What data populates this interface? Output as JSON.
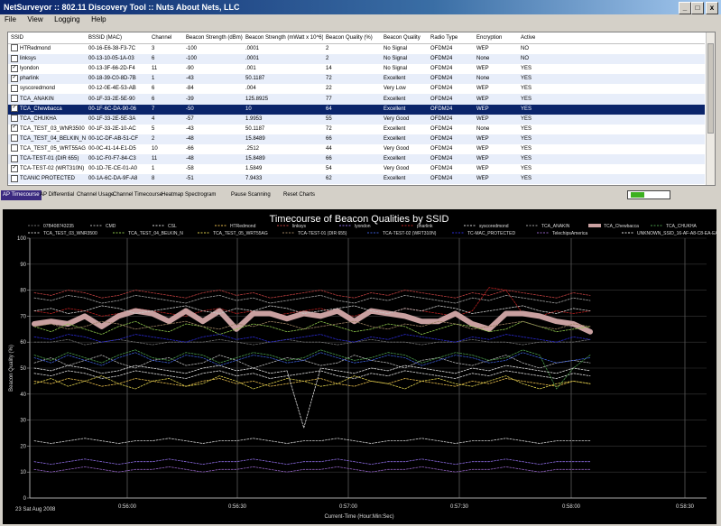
{
  "window": {
    "title": "NetSurveyor :: 802.11 Discovery Tool :: Nuts About Nets, LLC",
    "buttons": [
      "_",
      "□",
      "x"
    ]
  },
  "menu": [
    "File",
    "View",
    "Logging",
    "Help"
  ],
  "table": {
    "columns": [
      "SSID",
      "BSSID (MAC)",
      "Channel",
      "Beacon Strength (dBm)",
      "Beacon Strength (mWatt x 10^6)",
      "Beacon Quality (%)",
      "Beacon Quality",
      "Radio Type",
      "Encryption",
      "Active"
    ],
    "rows": [
      {
        "checked": false,
        "ssid": "HTRedmond",
        "bssid": "00-16-E6-38-F3-7C",
        "channel": "3",
        "dbm": "-100",
        "mw": ".0001",
        "pct": "2",
        "quality": "No Signal",
        "radio": "OFDM24",
        "enc": "WEP",
        "active": "NO"
      },
      {
        "checked": false,
        "ssid": "linksys",
        "bssid": "00-13-10-05-1A-03",
        "channel": "6",
        "dbm": "-100",
        "mw": ".0001",
        "pct": "2",
        "quality": "No Signal",
        "radio": "OFDM24",
        "enc": "None",
        "active": "NO"
      },
      {
        "checked": true,
        "ssid": "lyondon",
        "bssid": "00-13-3F-66-2D-F4",
        "channel": "11",
        "dbm": "-90",
        "mw": ".001",
        "pct": "14",
        "quality": "No Signal",
        "radio": "OFDM24",
        "enc": "WEP",
        "active": "YES"
      },
      {
        "checked": true,
        "ssid": "pharlink",
        "bssid": "00-18-39-C0-8D-7B",
        "channel": "1",
        "dbm": "-43",
        "mw": "50.1187",
        "pct": "72",
        "quality": "Excellent",
        "radio": "OFDM24",
        "enc": "None",
        "active": "YES"
      },
      {
        "checked": false,
        "ssid": "syscoredmond",
        "bssid": "00-12-0E-4E-53-AB",
        "channel": "6",
        "dbm": "-84",
        "mw": ".004",
        "pct": "22",
        "quality": "Very Low",
        "radio": "OFDM24",
        "enc": "WEP",
        "active": "YES"
      },
      {
        "checked": false,
        "ssid": "TCA_ANAKIN",
        "bssid": "00-1F-33-2E-5E-90",
        "channel": "6",
        "dbm": "-39",
        "mw": "125.8925",
        "pct": "77",
        "quality": "Excellent",
        "radio": "OFDM24",
        "enc": "WEP",
        "active": "YES"
      },
      {
        "checked": true,
        "ssid": "TCA_Chewbacca",
        "bssid": "00-1F-6C-DA-90-06",
        "channel": "7",
        "dbm": "-50",
        "mw": "10",
        "pct": "64",
        "quality": "Excellent",
        "radio": "OFDM24",
        "enc": "WEP",
        "active": "YES"
      },
      {
        "checked": false,
        "ssid": "TCA_CHUKHA",
        "bssid": "00-1F-33-2E-5E-3A",
        "channel": "4",
        "dbm": "-57",
        "mw": "1.9953",
        "pct": "55",
        "quality": "Very Good",
        "radio": "OFDM24",
        "enc": "WEP",
        "active": "YES"
      },
      {
        "checked": true,
        "ssid": "TCA_TEST_03_WNR3500",
        "bssid": "00-1F-33-2E-10-AC",
        "channel": "5",
        "dbm": "-43",
        "mw": "50.1187",
        "pct": "72",
        "quality": "Excellent",
        "radio": "OFDM24",
        "enc": "None",
        "active": "YES"
      },
      {
        "checked": false,
        "ssid": "TCA_TEST_04_BELKIN_N",
        "bssid": "00-1C-DF-AB-51-CF",
        "channel": "2",
        "dbm": "-48",
        "mw": "15.8489",
        "pct": "66",
        "quality": "Excellent",
        "radio": "OFDM24",
        "enc": "WEP",
        "active": "YES"
      },
      {
        "checked": false,
        "ssid": "TCA_TEST_05_WRT55AG",
        "bssid": "00-0C-41-14-E1-D5",
        "channel": "10",
        "dbm": "-66",
        "mw": ".2512",
        "pct": "44",
        "quality": "Very Good",
        "radio": "OFDM24",
        "enc": "WEP",
        "active": "YES"
      },
      {
        "checked": false,
        "ssid": "TCA-TEST-01 (DIR 655)",
        "bssid": "00-1C-F0-F7-84-C3",
        "channel": "11",
        "dbm": "-48",
        "mw": "15.8489",
        "pct": "66",
        "quality": "Excellent",
        "radio": "OFDM24",
        "enc": "WEP",
        "active": "YES"
      },
      {
        "checked": true,
        "ssid": "TCA-TEST-02 (WRT310N)",
        "bssid": "00-1D-7E-CE-01-A0",
        "channel": "1",
        "dbm": "-58",
        "mw": "1.5849",
        "pct": "54",
        "quality": "Very Good",
        "radio": "OFDM24",
        "enc": "WEP",
        "active": "YES"
      },
      {
        "checked": false,
        "ssid": "TCANIC PROTECTED",
        "bssid": "00-1A-6C-DA-9F-A8",
        "channel": "8",
        "dbm": "-51",
        "mw": "7.9433",
        "pct": "62",
        "quality": "Excellent",
        "radio": "OFDM24",
        "enc": "WEP",
        "active": "YES"
      }
    ],
    "selected_row": 6
  },
  "tabs": [
    "AP Timecourse",
    "AP Differential",
    "Channel Usage",
    "Channel Timecourse",
    "Heatmap",
    "Spectrogram",
    "Pause Scanning",
    "Reset Charts"
  ],
  "active_tab": 0,
  "meter_level_fraction": 0.35,
  "chart_data": {
    "type": "line",
    "title": "Timecourse of Beacon Qualities by SSID",
    "xlabel": "Current-Time (Hour:Min:Sec)",
    "ylabel": "Beacon Quality (%)",
    "date_label": "23 Sat Aug 2008",
    "ylim": [
      0,
      100
    ],
    "yticks": [
      0,
      10,
      20,
      30,
      40,
      50,
      60,
      70,
      80,
      90,
      100
    ],
    "xticks": [
      "0:56:00",
      "0:56:30",
      "0:57:00",
      "0:57:30",
      "0:58:00",
      "0:58:30"
    ],
    "grid": true,
    "legend_placement": "top",
    "series": [
      {
        "name": "07B408743235",
        "color": "#6f6f6f",
        "values": [
          60,
          60,
          61,
          59,
          60,
          61,
          60,
          59,
          60,
          60,
          60,
          61,
          60,
          59,
          60,
          61,
          60,
          60,
          59,
          60,
          61,
          60,
          60,
          59,
          60,
          60,
          61,
          60,
          60,
          59,
          60,
          60,
          60,
          61
        ]
      },
      {
        "name": "CMD",
        "color": "#b0b0b0",
        "values": [
          52,
          54,
          51,
          53,
          55,
          52,
          50,
          53,
          54,
          51,
          52,
          55,
          53,
          50,
          52,
          54,
          53,
          51,
          52,
          55,
          53,
          52,
          50,
          53,
          54,
          52,
          51,
          53,
          55,
          52,
          50,
          52,
          53,
          52
        ]
      },
      {
        "name": "CSL",
        "color": "#d8d8d8",
        "values": [
          48,
          47,
          49,
          48,
          46,
          47,
          49,
          48,
          47,
          46,
          48,
          49,
          47,
          48,
          46,
          47,
          48,
          49,
          47,
          46,
          48,
          47,
          49,
          48,
          47,
          46,
          48,
          47,
          49,
          48,
          47,
          46,
          48,
          47
        ]
      },
      {
        "name": "HTRedmond",
        "color": "#e3b94a",
        "values": [
          45,
          44,
          46,
          45,
          43,
          44,
          46,
          45,
          44,
          43,
          45,
          46,
          44,
          45,
          43,
          44,
          45,
          46,
          44,
          43,
          45,
          44,
          46,
          45,
          44,
          43,
          45,
          44,
          46,
          45,
          44,
          43,
          45,
          44
        ]
      },
      {
        "name": "linksys",
        "color": "#c04040",
        "values": [
          79,
          78,
          80,
          79,
          77,
          78,
          80,
          79,
          78,
          77,
          79,
          80,
          78,
          79,
          77,
          78,
          79,
          80,
          78,
          77,
          79,
          78,
          80,
          79,
          78,
          77,
          79,
          78,
          80,
          79,
          78,
          77,
          79,
          78
        ]
      },
      {
        "name": "lyondon",
        "color": "#8a6adf",
        "values": [
          14,
          13,
          14,
          15,
          14,
          13,
          14,
          14,
          15,
          14,
          13,
          14,
          14,
          15,
          14,
          13,
          14,
          14,
          15,
          14,
          13,
          14,
          14,
          15,
          14,
          13,
          14,
          14,
          15,
          14,
          13,
          14,
          14,
          14
        ]
      },
      {
        "name": "pharlink",
        "color": "#b82020",
        "values": [
          72,
          71,
          73,
          72,
          70,
          71,
          73,
          72,
          71,
          70,
          72,
          73,
          71,
          72,
          70,
          71,
          72,
          73,
          71,
          70,
          72,
          71,
          73,
          72,
          71,
          70,
          72,
          81,
          80,
          71,
          70,
          72,
          71,
          72
        ]
      },
      {
        "name": "syscoredmond",
        "color": "#d0d0d0",
        "values": [
          22,
          21,
          22,
          23,
          22,
          21,
          22,
          22,
          23,
          22,
          21,
          22,
          22,
          23,
          22,
          21,
          22,
          22,
          23,
          22,
          21,
          22,
          22,
          23,
          22,
          21,
          22,
          22,
          23,
          22,
          21,
          22,
          22,
          22
        ]
      },
      {
        "name": "TCA_ANAKIN",
        "color": "#a0a0a0",
        "values": [
          77,
          76,
          78,
          77,
          75,
          76,
          78,
          77,
          76,
          75,
          77,
          78,
          76,
          77,
          75,
          76,
          77,
          78,
          76,
          75,
          77,
          76,
          78,
          77,
          76,
          75,
          77,
          76,
          78,
          77,
          76,
          75,
          77,
          76
        ]
      },
      {
        "name": "TCA_Chewbacca",
        "color": "#c9a0a0",
        "values": [
          67,
          68,
          67,
          70,
          66,
          70,
          72,
          71,
          68,
          72,
          68,
          72,
          65,
          71,
          71,
          69,
          71,
          70,
          72,
          68,
          72,
          71,
          70,
          68,
          68,
          71,
          67,
          65,
          71,
          71,
          70,
          68,
          67,
          64
        ]
      },
      {
        "name": "TCA_CHUKHA",
        "color": "#4a9a4a",
        "values": [
          55,
          53,
          56,
          54,
          52,
          55,
          57,
          54,
          53,
          56,
          55,
          52,
          54,
          56,
          55,
          53,
          54,
          57,
          55,
          53,
          54,
          56,
          55,
          52,
          54,
          56,
          55,
          53,
          54,
          57,
          55,
          42,
          50,
          55
        ]
      },
      {
        "name": "TCA_TEST_03_WNR3500",
        "color": "#c8c8c8",
        "values": [
          72,
          73,
          71,
          72,
          74,
          73,
          71,
          72,
          73,
          74,
          72,
          71,
          73,
          72,
          74,
          73,
          71,
          72,
          73,
          74,
          72,
          71,
          73,
          72,
          74,
          73,
          71,
          72,
          73,
          74,
          72,
          71,
          73,
          72
        ]
      },
      {
        "name": "TCA_TEST_04_BELKIN_N",
        "color": "#8bc34a",
        "values": [
          66,
          64,
          67,
          65,
          63,
          66,
          68,
          65,
          64,
          67,
          66,
          63,
          65,
          67,
          66,
          64,
          65,
          68,
          66,
          64,
          65,
          67,
          66,
          63,
          65,
          67,
          66,
          64,
          65,
          68,
          66,
          64,
          65,
          66
        ]
      },
      {
        "name": "TCA_TEST_05_WRT55AG",
        "color": "#d7c94a",
        "values": [
          44,
          46,
          43,
          45,
          47,
          44,
          42,
          45,
          46,
          43,
          44,
          47,
          45,
          42,
          44,
          46,
          45,
          43,
          44,
          47,
          45,
          44,
          42,
          45,
          46,
          44,
          43,
          45,
          47,
          44,
          42,
          44,
          45,
          44
        ]
      },
      {
        "name": "TCA-TEST-01 (DIR 655)",
        "color": "#9a8060",
        "values": [
          66,
          67,
          65,
          66,
          68,
          67,
          65,
          66,
          67,
          68,
          66,
          65,
          67,
          66,
          68,
          67,
          65,
          66,
          67,
          68,
          66,
          65,
          67,
          66,
          68,
          67,
          65,
          66,
          67,
          68,
          66,
          65,
          67,
          66
        ]
      },
      {
        "name": "TCA-TEST-02 (WRT310N)",
        "color": "#3a5ad0",
        "values": [
          54,
          52,
          55,
          53,
          51,
          54,
          56,
          53,
          52,
          55,
          54,
          51,
          53,
          55,
          54,
          52,
          53,
          56,
          54,
          52,
          53,
          55,
          54,
          51,
          53,
          55,
          54,
          52,
          53,
          56,
          54,
          52,
          53,
          54
        ]
      },
      {
        "name": "TC-MAC_PROTECTED",
        "color": "#2a2ad0",
        "values": [
          62,
          61,
          63,
          62,
          60,
          61,
          63,
          62,
          61,
          60,
          62,
          63,
          61,
          62,
          60,
          61,
          62,
          63,
          61,
          60,
          62,
          61,
          63,
          62,
          61,
          60,
          62,
          61,
          63,
          62,
          61,
          60,
          62,
          61
        ]
      },
      {
        "name": "TelechipsAmerica",
        "color": "#9060c0",
        "values": [
          11,
          10,
          11,
          12,
          11,
          10,
          11,
          11,
          12,
          11,
          10,
          11,
          11,
          12,
          11,
          10,
          11,
          11,
          12,
          11,
          10,
          11,
          11,
          12,
          11,
          10,
          11,
          11,
          12,
          11,
          10,
          11,
          11,
          11
        ]
      },
      {
        "name": "UNKNOWN_SSID_16-AF-A8-C8-EA-EA",
        "color": "#e0e0e0",
        "values": [
          50,
          49,
          51,
          50,
          48,
          49,
          51,
          50,
          49,
          48,
          50,
          51,
          49,
          50,
          48,
          49,
          27,
          50,
          49,
          48,
          50,
          49,
          51,
          50,
          49,
          48,
          50,
          49,
          51,
          50,
          49,
          48,
          50,
          49
        ]
      }
    ]
  }
}
